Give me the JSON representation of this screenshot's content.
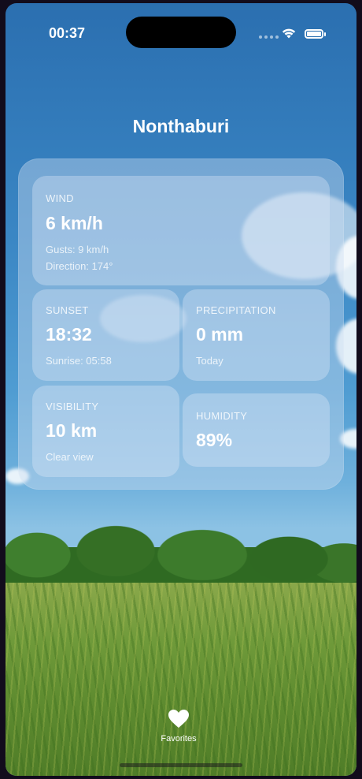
{
  "status_bar": {
    "time": "00:37"
  },
  "location": {
    "city": "Nonthaburi"
  },
  "cards": {
    "wind": {
      "label": "WIND",
      "value": "6 km/h",
      "gusts": "Gusts: 9 km/h",
      "direction": "Direction: 174°"
    },
    "sunset": {
      "label": "SUNSET",
      "value": "18:32",
      "sub": "Sunrise: 05:58"
    },
    "precipitation": {
      "label": "PRECIPITATION",
      "value": "0 mm",
      "sub": "Today"
    },
    "visibility": {
      "label": "VISIBILITY",
      "value": "10 km",
      "sub": "Clear view"
    },
    "humidity": {
      "label": "HUMIDITY",
      "value": "89%"
    }
  },
  "tab_bar": {
    "favorites_label": "Favorites",
    "favorites_icon": "heart-icon"
  }
}
